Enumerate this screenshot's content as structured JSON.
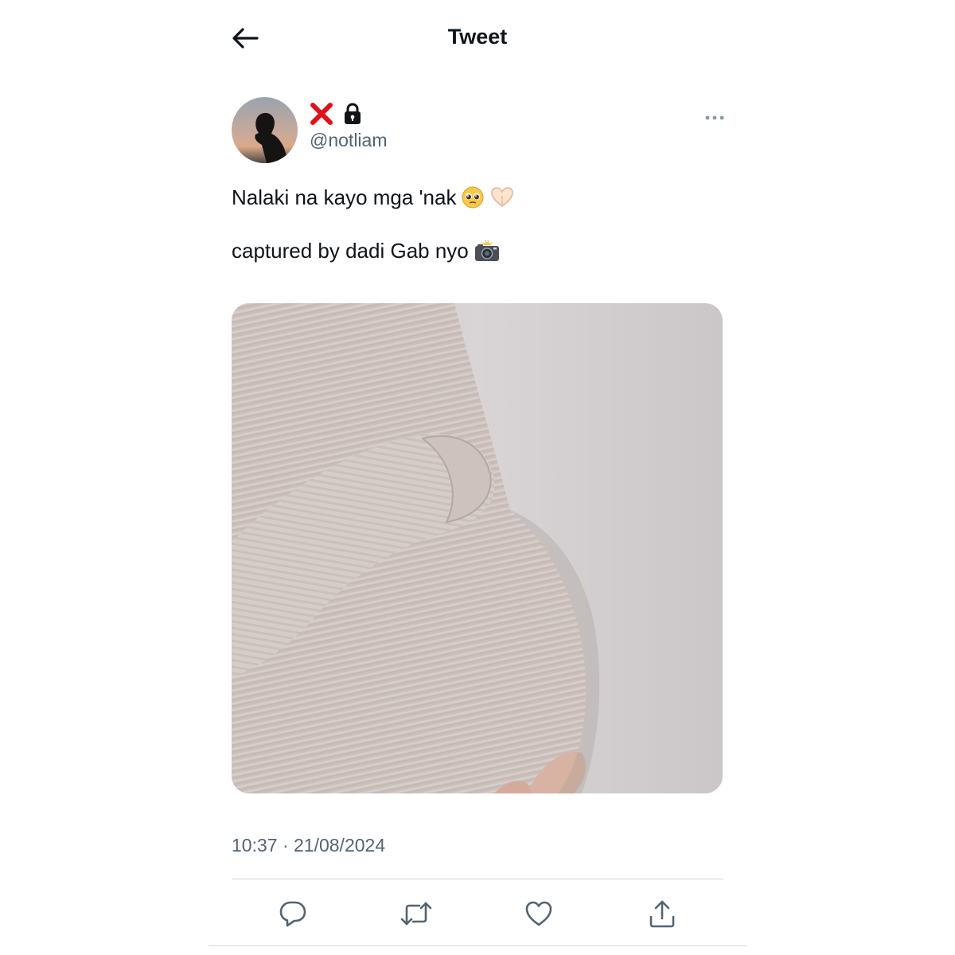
{
  "header": {
    "title": "Tweet",
    "back_icon": "arrow-left-icon"
  },
  "author": {
    "display_name_icons": [
      "red-cross-mark-icon",
      "lock-icon"
    ],
    "handle": "@notliam",
    "avatar": "silhouette-avatar"
  },
  "tweet": {
    "line1": "Nalaki na kayo mga 'nak",
    "line1_emojis": [
      "pleading-face-emoji",
      "heart-hands-emoji"
    ],
    "line2": "captured by dadi Gab nyo",
    "line2_emojis": [
      "camera-with-flash-emoji"
    ],
    "media": "photo-corduroy-sweater",
    "timestamp": "10:37 · 21/08/2024"
  },
  "actions": [
    "reply-icon",
    "retweet-icon",
    "like-icon",
    "share-icon"
  ],
  "colors": {
    "text": "#0f1419",
    "secondary": "#536471",
    "divider": "#cfd9de",
    "cross": "#e0111b"
  }
}
